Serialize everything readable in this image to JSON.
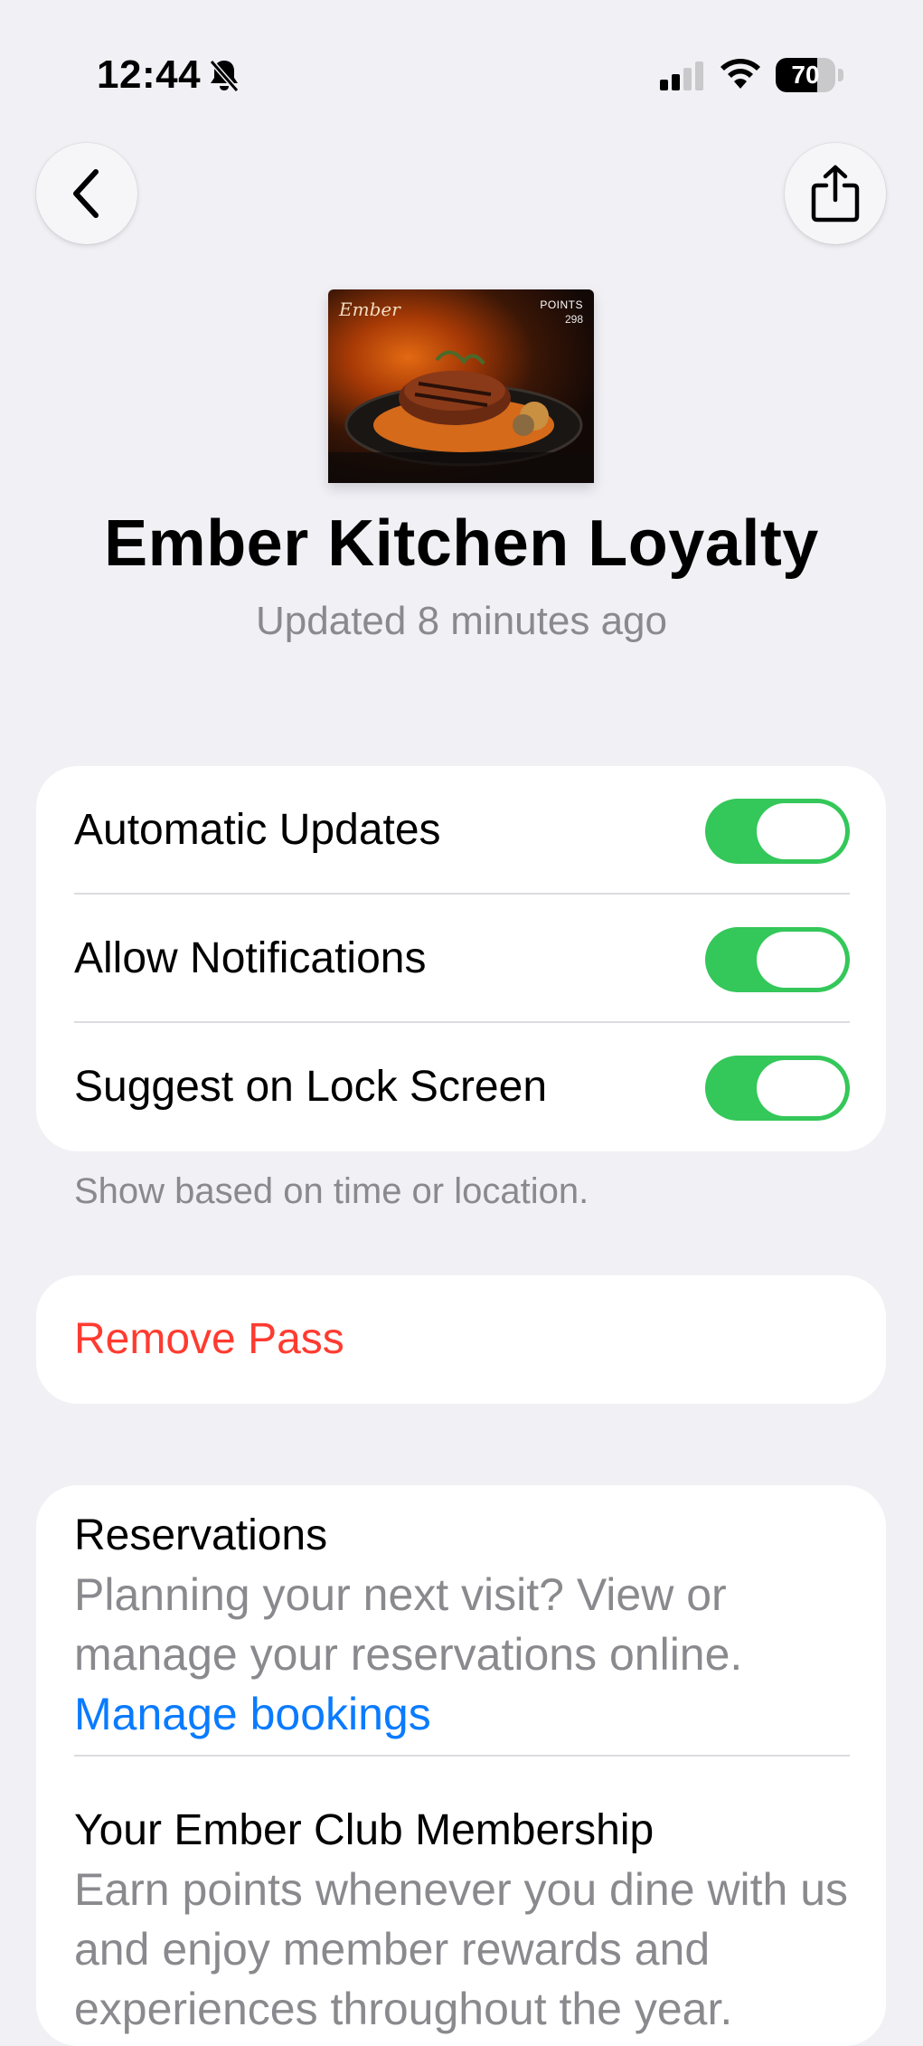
{
  "status_bar": {
    "time": "12:44",
    "battery_percent": "70",
    "battery_level": 0.7
  },
  "nav": {
    "back_icon": "chevron-left-icon",
    "share_icon": "share-icon"
  },
  "pass": {
    "logo_text": "Ember",
    "points_label": "POINTS",
    "points_value": "298"
  },
  "header": {
    "title": "Ember Kitchen Loyalty",
    "subtitle": "Updated 8 minutes ago"
  },
  "settings": {
    "items": [
      {
        "label": "Automatic Updates",
        "on": true
      },
      {
        "label": "Allow Notifications",
        "on": true
      },
      {
        "label": "Suggest on Lock Screen",
        "on": true
      }
    ],
    "footnote": "Show based on time or location."
  },
  "actions": {
    "remove_label": "Remove Pass"
  },
  "info": {
    "reservations": {
      "title": "Reservations",
      "text": "Planning your next visit? View or manage your reservations online.",
      "link": "Manage bookings"
    },
    "membership": {
      "title": "Your Ember Club Membership",
      "text": "Earn points whenever you dine with us and enjoy member rewards and experiences throughout the year."
    }
  },
  "colors": {
    "toggle_on": "#34c759",
    "destructive": "#ff3b30",
    "link": "#0a7bff",
    "background": "#f0f0f5"
  }
}
